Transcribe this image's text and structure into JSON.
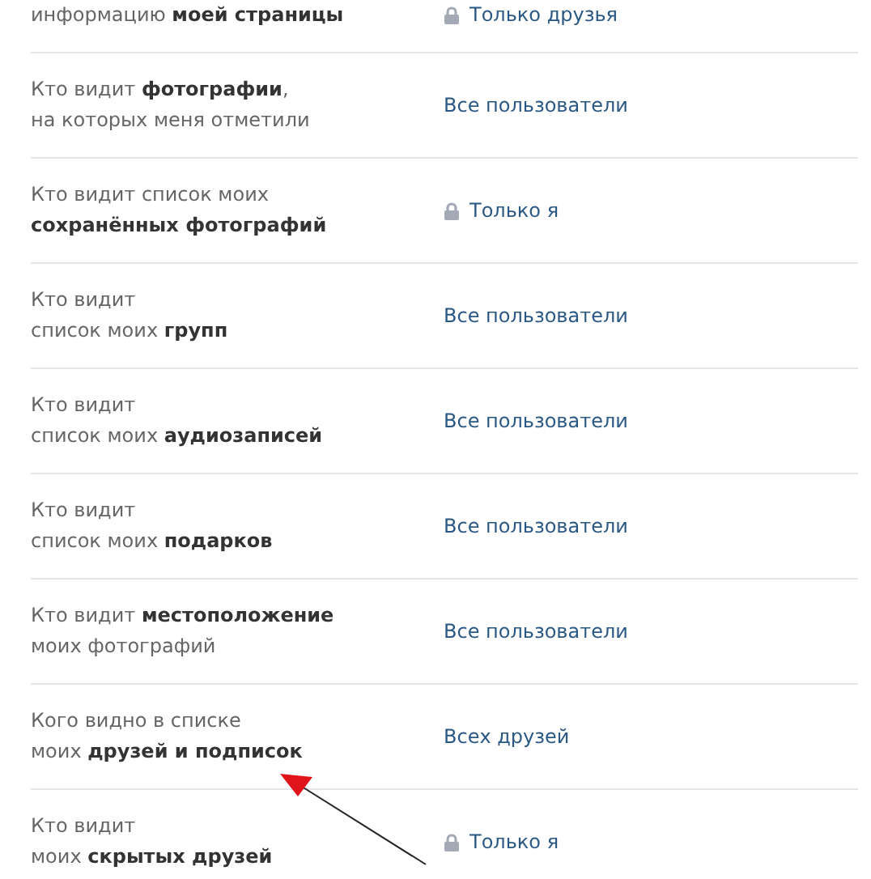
{
  "settings": [
    {
      "lines": [
        "информацию **моей страницы**"
      ],
      "value": "Только друзья",
      "locked": true
    },
    {
      "lines": [
        "Кто видит **фотографии**,",
        "на которых меня отметили"
      ],
      "value": "Все пользователи",
      "locked": false
    },
    {
      "lines": [
        "Кто видит список моих",
        "**сохранённых фотографий**"
      ],
      "value": "Только я",
      "locked": true
    },
    {
      "lines": [
        "Кто видит",
        "список моих **групп**"
      ],
      "value": "Все пользователи",
      "locked": false
    },
    {
      "lines": [
        "Кто видит",
        "список моих **аудиозаписей**"
      ],
      "value": "Все пользователи",
      "locked": false
    },
    {
      "lines": [
        "Кто видит",
        "список моих **подарков**"
      ],
      "value": "Все пользователи",
      "locked": false
    },
    {
      "lines": [
        "Кто видит **местоположение**",
        "моих фотографий"
      ],
      "value": "Все пользователи",
      "locked": false
    },
    {
      "lines": [
        "Кого видно в списке",
        "моих **друзей и подписок**"
      ],
      "value": "Всех друзей",
      "locked": false
    },
    {
      "lines": [
        "Кто видит",
        "моих **скрытых друзей**"
      ],
      "value": "Только я",
      "locked": true
    }
  ]
}
